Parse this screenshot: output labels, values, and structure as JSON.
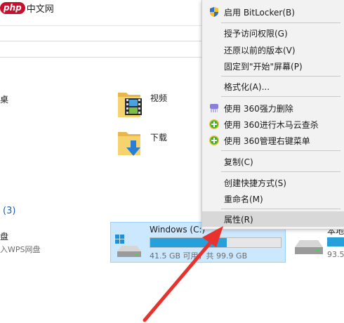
{
  "watermark": {
    "php": "php",
    "site": "中文网"
  },
  "content": {
    "left_partial_label": "桌",
    "videos_label": "视频",
    "downloads_label": "下载",
    "section_count": "(3)",
    "disk_partial_label": "盘",
    "wps_partial_label": "入WPS网盘"
  },
  "drive_c": {
    "name": "Windows (C:)",
    "size_text": "41.5 GB 可用，共 99.9 GB",
    "used_fraction": 0.585
  },
  "drive_next": {
    "name_partial": "本地",
    "size_partial": "93.5"
  },
  "context_menu": {
    "items": [
      {
        "label": "启用 BitLocker(B)",
        "icon": "shield-icon"
      },
      {
        "label": "授予访问权限(G)",
        "icon": ""
      },
      {
        "label": "还原以前的版本(V)",
        "icon": ""
      },
      {
        "label": "固定到\"开始\"屏幕(P)",
        "icon": ""
      },
      {
        "label": "格式化(A)...",
        "icon": ""
      },
      {
        "label": "使用 360强力删除",
        "icon": "360-shredder-icon"
      },
      {
        "label": "使用 360进行木马云查杀",
        "icon": "360-plus-icon"
      },
      {
        "label": "使用 360管理右键菜单",
        "icon": "360-plus-icon"
      },
      {
        "label": "复制(C)",
        "icon": ""
      },
      {
        "label": "创建快捷方式(S)",
        "icon": ""
      },
      {
        "label": "重命名(M)",
        "icon": ""
      },
      {
        "label": "属性(R)",
        "icon": ""
      }
    ]
  },
  "colors": {
    "accent": "#26a0da",
    "selection": "#cce8ff",
    "menu_bg": "#f2f2f2",
    "arrow": "#e8322d"
  }
}
